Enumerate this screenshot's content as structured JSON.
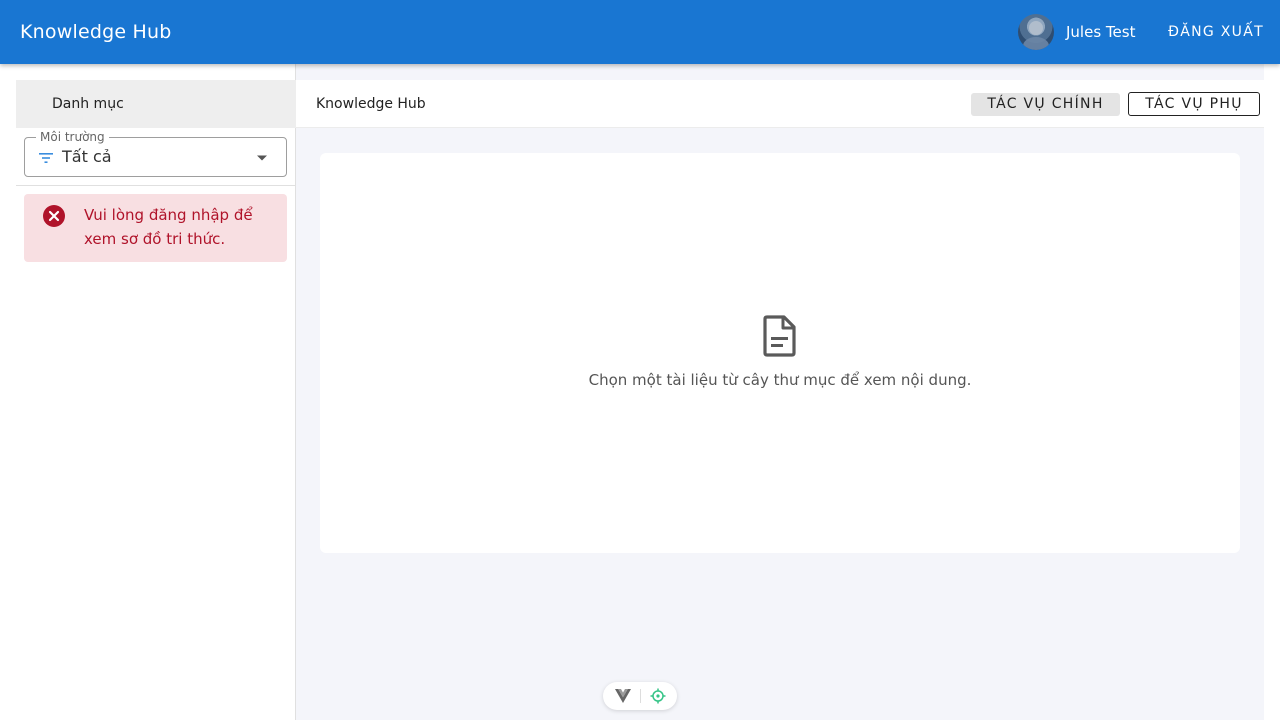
{
  "app": {
    "title": "Knowledge Hub",
    "user_name": "Jules Test",
    "logout_label": "ĐĂNG XUẤT",
    "accent_color": "#1976d2"
  },
  "sidebar": {
    "title": "Danh mục",
    "environment": {
      "label": "Môi trường",
      "value": "Tất cả",
      "icon": "filter-icon"
    },
    "alert": {
      "message": "Vui lòng đăng nhập để xem sơ đồ tri thức.",
      "icon": "error-circle-icon",
      "color": "#b0132a",
      "background": "#f8dfe2"
    }
  },
  "main": {
    "breadcrumb": "Knowledge Hub",
    "primary_action_label": "TÁC VỤ CHÍNH",
    "secondary_action_label": "TÁC VỤ PHỤ",
    "empty_state": {
      "icon": "document-icon",
      "message": "Chọn một tài liệu từ cây thư mục để xem nội dung."
    }
  },
  "devtools": {
    "icons": [
      "vue-logo-icon",
      "crosshair-target-icon"
    ]
  }
}
